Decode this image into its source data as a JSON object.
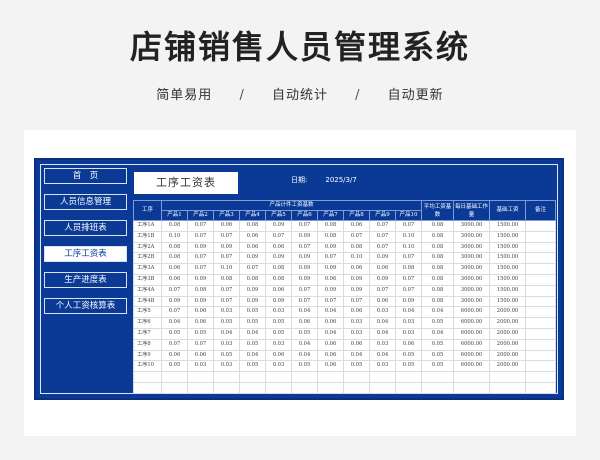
{
  "header": {
    "title": "店铺销售人员管理系统",
    "features": [
      "简单易用",
      "自动统计",
      "自动更新"
    ],
    "separator": "/"
  },
  "nav": {
    "items": [
      {
        "label": "首　页",
        "active": false
      },
      {
        "label": "人员信息管理",
        "active": false
      },
      {
        "label": "人员排班表",
        "active": false
      },
      {
        "label": "工序工资表",
        "active": true
      },
      {
        "label": "生产进度表",
        "active": false
      },
      {
        "label": "个人工资核算表",
        "active": false
      }
    ]
  },
  "sheet": {
    "title": "工序工资表",
    "date_label": "日期:",
    "date_value": "2025/3/7"
  },
  "table": {
    "col_process": "工序",
    "group_header": "产品计件工资基数",
    "products": [
      "产品1",
      "产品2",
      "产品3",
      "产品4",
      "产品5",
      "产品6",
      "产品7",
      "产品8",
      "产品9",
      "产品10"
    ],
    "col_avg": "平均工资基数",
    "col_daily": "每日基础工作量",
    "col_base": "基础工资",
    "col_note": "备注",
    "rows": [
      {
        "process": "工序1A",
        "p": [
          "0.08",
          "0.07",
          "0.06",
          "0.08",
          "0.09",
          "0.07",
          "0.08",
          "0.06",
          "0.07",
          "0.07"
        ],
        "avg": "0.08",
        "daily": "3000.00",
        "base": "1500.00",
        "note": ""
      },
      {
        "process": "工序1B",
        "p": [
          "0.10",
          "0.07",
          "0.07",
          "0.06",
          "0.07",
          "0.09",
          "0.08",
          "0.07",
          "0.07",
          "0.10"
        ],
        "avg": "0.08",
        "daily": "3000.00",
        "base": "1500.00",
        "note": ""
      },
      {
        "process": "工序2A",
        "p": [
          "0.08",
          "0.09",
          "0.09",
          "0.06",
          "0.06",
          "0.07",
          "0.09",
          "0.08",
          "0.07",
          "0.10"
        ],
        "avg": "0.08",
        "daily": "3000.00",
        "base": "1500.00",
        "note": ""
      },
      {
        "process": "工序2B",
        "p": [
          "0.08",
          "0.07",
          "0.07",
          "0.09",
          "0.09",
          "0.09",
          "0.07",
          "0.10",
          "0.09",
          "0.07"
        ],
        "avg": "0.08",
        "daily": "3000.00",
        "base": "1500.00",
        "note": ""
      },
      {
        "process": "工序3A",
        "p": [
          "0.06",
          "0.07",
          "0.10",
          "0.07",
          "0.08",
          "0.09",
          "0.09",
          "0.06",
          "0.06",
          "0.08"
        ],
        "avg": "0.08",
        "daily": "3000.00",
        "base": "1500.00",
        "note": ""
      },
      {
        "process": "工序3B",
        "p": [
          "0.06",
          "0.09",
          "0.08",
          "0.08",
          "0.08",
          "0.09",
          "0.06",
          "0.09",
          "0.09",
          "0.07"
        ],
        "avg": "0.08",
        "daily": "3000.00",
        "base": "1500.00",
        "note": ""
      },
      {
        "process": "工序4A",
        "p": [
          "0.07",
          "0.08",
          "0.07",
          "0.09",
          "0.06",
          "0.07",
          "0.09",
          "0.09",
          "0.07",
          "0.07"
        ],
        "avg": "0.08",
        "daily": "3000.00",
        "base": "1500.00",
        "note": ""
      },
      {
        "process": "工序4B",
        "p": [
          "0.09",
          "0.09",
          "0.07",
          "0.09",
          "0.09",
          "0.07",
          "0.07",
          "0.07",
          "0.06",
          "0.09"
        ],
        "avg": "0.08",
        "daily": "3000.00",
        "base": "1500.00",
        "note": ""
      },
      {
        "process": "工序5",
        "p": [
          "0.07",
          "0.06",
          "0.03",
          "0.05",
          "0.03",
          "0.04",
          "0.04",
          "0.06",
          "0.03",
          "0.04"
        ],
        "avg": "0.04",
        "daily": "6000.00",
        "base": "2000.00",
        "note": ""
      },
      {
        "process": "工序6",
        "p": [
          "0.04",
          "0.06",
          "0.05",
          "0.05",
          "0.05",
          "0.06",
          "0.06",
          "0.03",
          "0.04",
          "0.03"
        ],
        "avg": "0.05",
        "daily": "6000.00",
        "base": "2000.00",
        "note": ""
      },
      {
        "process": "工序7",
        "p": [
          "0.05",
          "0.05",
          "0.04",
          "0.04",
          "0.05",
          "0.05",
          "0.04",
          "0.03",
          "0.04",
          "0.03"
        ],
        "avg": "0.04",
        "daily": "6000.00",
        "base": "2000.00",
        "note": ""
      },
      {
        "process": "工序8",
        "p": [
          "0.07",
          "0.07",
          "0.03",
          "0.05",
          "0.03",
          "0.04",
          "0.06",
          "0.06",
          "0.03",
          "0.06"
        ],
        "avg": "0.05",
        "daily": "6000.00",
        "base": "2000.00",
        "note": ""
      },
      {
        "process": "工序9",
        "p": [
          "0.06",
          "0.06",
          "0.05",
          "0.04",
          "0.06",
          "0.04",
          "0.06",
          "0.04",
          "0.04",
          "0.05"
        ],
        "avg": "0.05",
        "daily": "6000.00",
        "base": "2000.00",
        "note": ""
      },
      {
        "process": "工序10",
        "p": [
          "0.05",
          "0.03",
          "0.03",
          "0.05",
          "0.03",
          "0.05",
          "0.06",
          "0.05",
          "0.03",
          "0.05"
        ],
        "avg": "0.05",
        "daily": "6000.00",
        "base": "2000.00",
        "note": ""
      }
    ]
  }
}
